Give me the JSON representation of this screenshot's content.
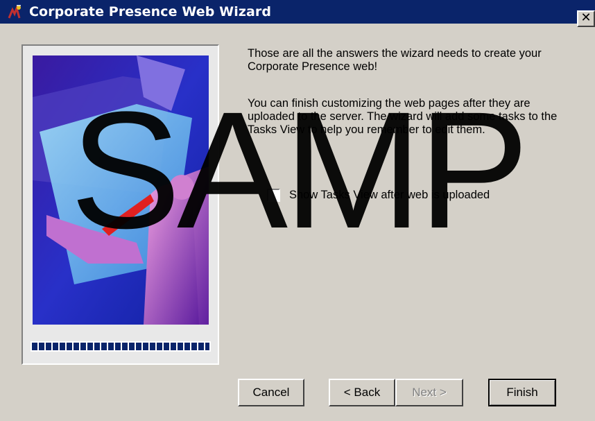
{
  "window": {
    "title": "Corporate Presence Web Wizard",
    "close_label": "✕",
    "title_bar_color": "#0a246a"
  },
  "content": {
    "paragraph1": "Those are all the answers the wizard needs to create your Corporate Presence web!",
    "paragraph2": "You can finish customizing the web pages after they are uploaded to the server. The wizard will add some tasks to the Tasks View to help you remember to edit them."
  },
  "checkbox": {
    "label": "Show Tasks View after web is uploaded",
    "checked": false
  },
  "buttons": {
    "cancel": "Cancel",
    "back": "< Back",
    "next": "Next >",
    "finish": "Finish",
    "next_disabled": true
  },
  "watermark": "SAMP",
  "progress": {
    "color": "#0a246a"
  }
}
